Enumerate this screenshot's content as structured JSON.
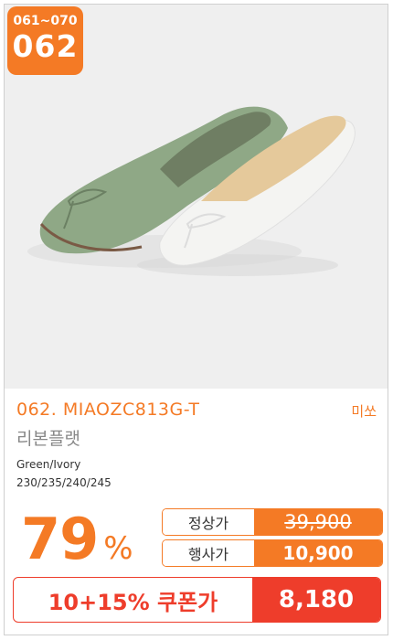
{
  "badge": {
    "range": "061~070",
    "number": "062"
  },
  "product": {
    "code": "062. MIAOZC813G-T",
    "brand": "미쏘",
    "name": "리본플랫",
    "colors": "Green/Ivory",
    "sizes": "230/235/240/245"
  },
  "pricing": {
    "discount_percent": "79",
    "percent_sign": "%",
    "regular_label": "정상가",
    "regular_price": "39,900",
    "event_label": "행사가",
    "event_price": "10,900",
    "coupon_label": "10+15% 쿠폰가",
    "coupon_price": "8,180"
  },
  "colors": {
    "accent": "#f47a25",
    "coupon": "#ee3d2b",
    "shoe_green": "#8fa886",
    "shoe_ivory": "#f4f4f2"
  }
}
